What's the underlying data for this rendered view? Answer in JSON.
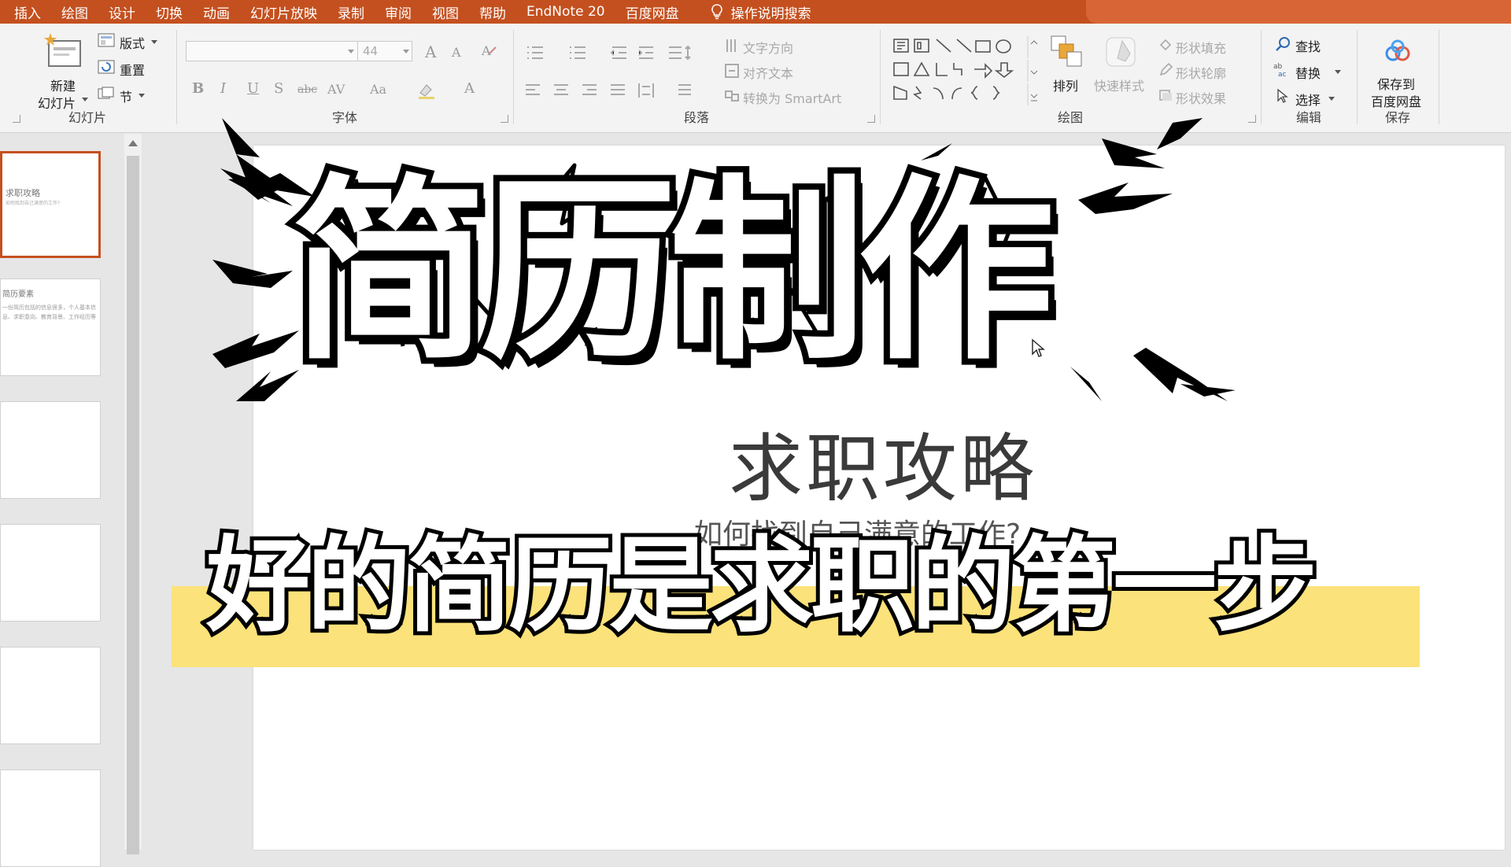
{
  "menu": {
    "tabs": [
      "插入",
      "绘图",
      "设计",
      "切换",
      "动画",
      "幻灯片放映",
      "录制",
      "审阅",
      "视图",
      "帮助",
      "EndNote 20",
      "百度网盘"
    ],
    "tell_me": "操作说明搜索"
  },
  "ribbon": {
    "slides_group": {
      "label": "幻灯片",
      "new_slide_line1": "新建",
      "new_slide_line2": "幻灯片",
      "layout": "版式",
      "reset": "重置",
      "section": "节"
    },
    "font_group": {
      "label": "字体",
      "font_name": "",
      "font_size": "44",
      "bold": "B",
      "italic": "I",
      "underline": "U",
      "shadow": "S",
      "strike": "abc",
      "spacing": "AV",
      "case": "Aa",
      "color": "A"
    },
    "paragraph_group": {
      "label": "段落",
      "text_direction": "文字方向",
      "align_text": "对齐文本",
      "convert_smartart": "转换为 SmartArt"
    },
    "drawing_group": {
      "label": "绘图",
      "arrange": "排列",
      "quick_styles": "快速样式",
      "shape_fill": "形状填充",
      "shape_outline": "形状轮廓",
      "shape_effects": "形状效果"
    },
    "editing_group": {
      "label": "编辑",
      "find": "查找",
      "replace": "替换",
      "select": "选择"
    },
    "save_group": {
      "label": "保存",
      "save_line1": "保存到",
      "save_line2": "百度网盘"
    }
  },
  "thumbnails": {
    "slide1_title": "求职攻略",
    "slide1_sub": "如何找到自己满意的工作?",
    "slide2_title": "简历要素",
    "slide2_body": "一份简历包括的信息很多，个人基本信息、求职意向、教育背景、工作经历等"
  },
  "slide": {
    "title": "求职攻略",
    "subtitle": "如何找到自己满意的工作?"
  },
  "overlay": {
    "headline": "简历制作",
    "caption": "好的简历是求职的第一步"
  },
  "colors": {
    "accent": "#c4501f",
    "highlight": "#fbe27a"
  }
}
